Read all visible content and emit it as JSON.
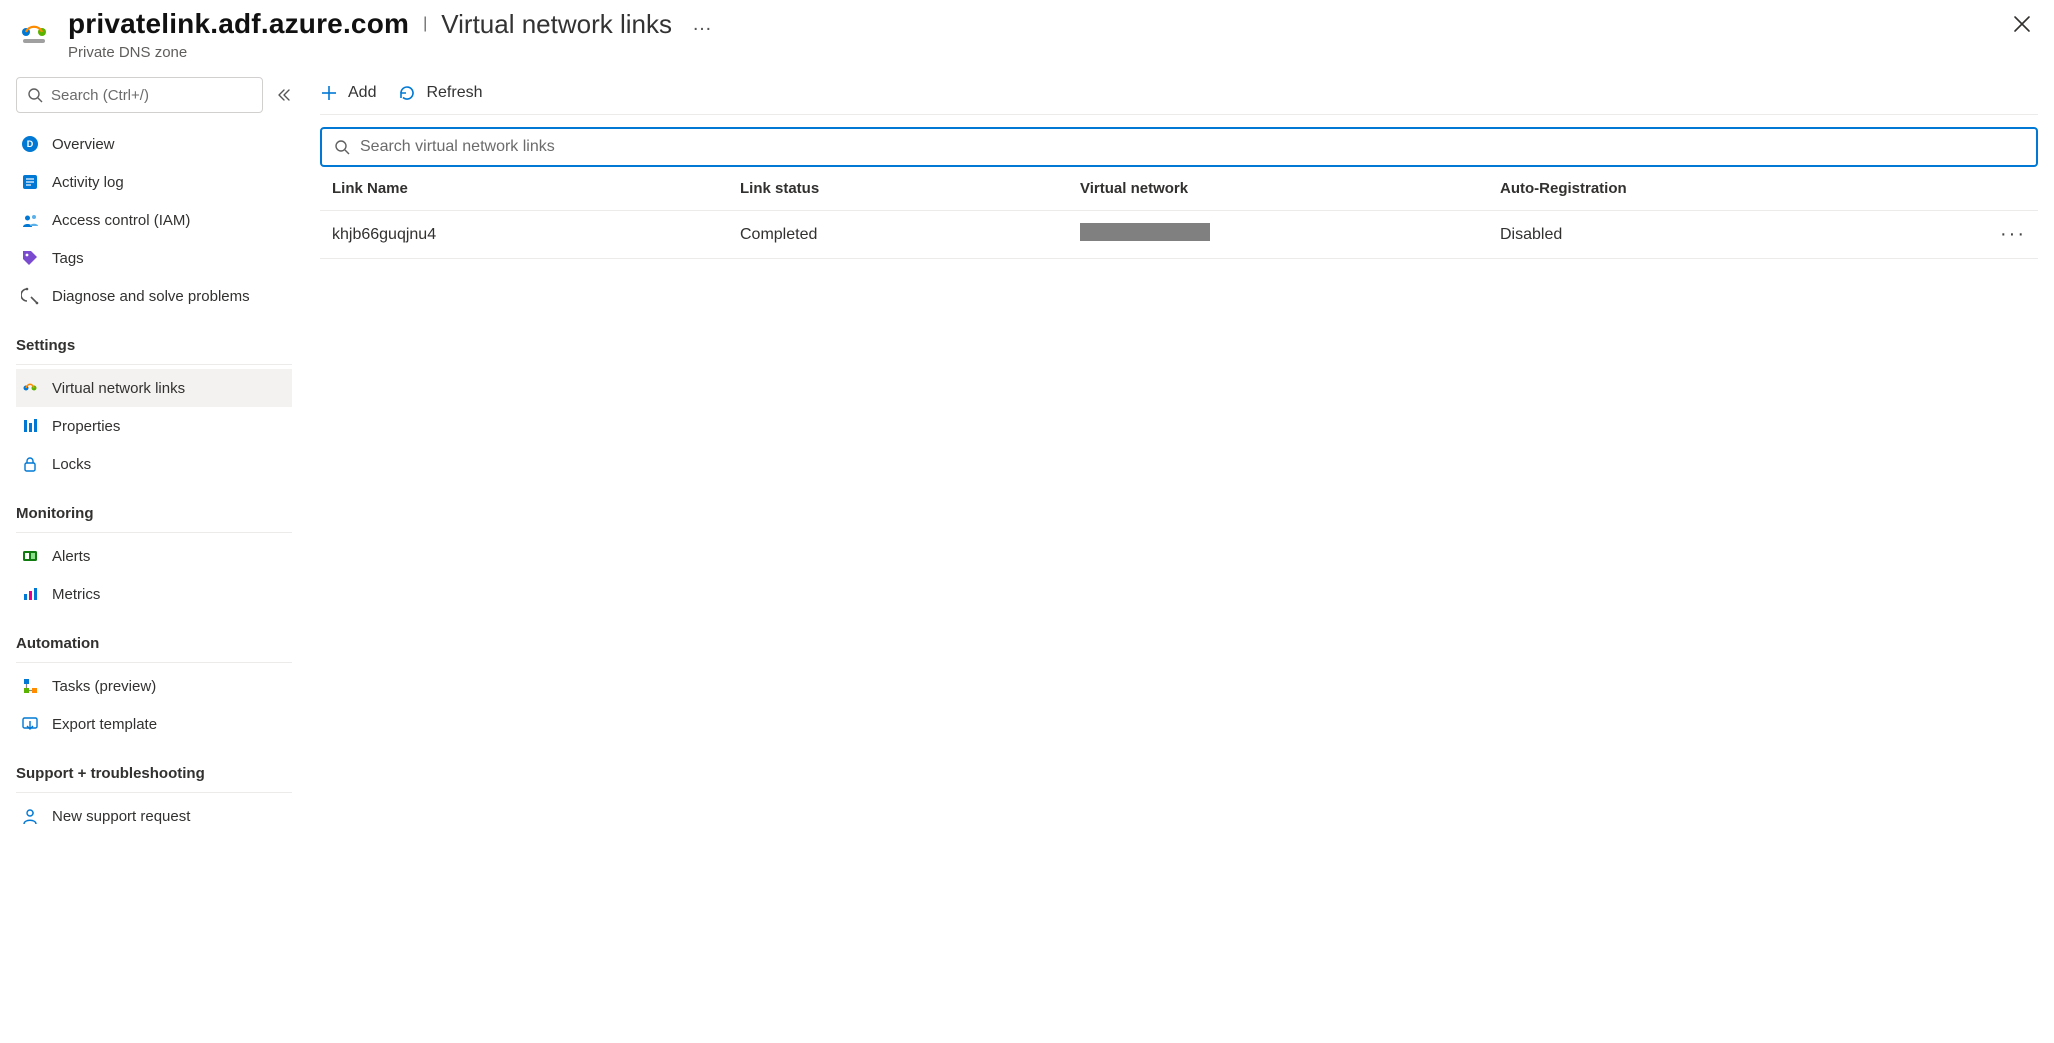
{
  "header": {
    "zone_name": "privatelink.adf.azure.com",
    "page_name": "Virtual network links",
    "resource_type": "Private DNS zone"
  },
  "sidebar": {
    "search_placeholder": "Search (Ctrl+/)",
    "items_top": [
      {
        "label": "Overview"
      },
      {
        "label": "Activity log"
      },
      {
        "label": "Access control (IAM)"
      },
      {
        "label": "Tags"
      },
      {
        "label": "Diagnose and solve problems"
      }
    ],
    "section_settings": "Settings",
    "items_settings": [
      {
        "label": "Virtual network links"
      },
      {
        "label": "Properties"
      },
      {
        "label": "Locks"
      }
    ],
    "section_monitoring": "Monitoring",
    "items_monitoring": [
      {
        "label": "Alerts"
      },
      {
        "label": "Metrics"
      }
    ],
    "section_automation": "Automation",
    "items_automation": [
      {
        "label": "Tasks (preview)"
      },
      {
        "label": "Export template"
      }
    ],
    "section_support": "Support + troubleshooting",
    "items_support": [
      {
        "label": "New support request"
      }
    ]
  },
  "toolbar": {
    "add": "Add",
    "refresh": "Refresh"
  },
  "search": {
    "placeholder": "Search virtual network links"
  },
  "table": {
    "headers": {
      "link_name": "Link Name",
      "link_status": "Link status",
      "vnet": "Virtual network",
      "auto": "Auto-Registration"
    },
    "rows": [
      {
        "link_name": "khjb66guqjnu4",
        "link_status": "Completed",
        "vnet": "",
        "auto": "Disabled"
      }
    ]
  }
}
